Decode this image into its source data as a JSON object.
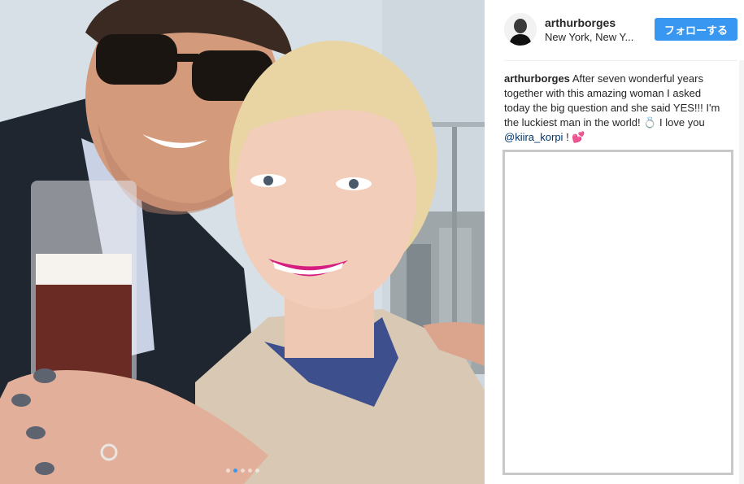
{
  "post": {
    "username": "arthurborges",
    "location": "New York, New Y...",
    "follow_label": "フォローする",
    "caption_user": "arthurborges",
    "caption_text": "After seven wonderful years together with this amazing woman I asked today the big question and she said YES!!! I'm the luckiest man in the world! 💍 I love you ",
    "caption_mention": "@kiira_korpi",
    "caption_end": " ! 💕",
    "carousel_count": 5,
    "carousel_active_index": 1
  },
  "colors": {
    "accent": "#3897f0",
    "mention": "#003569",
    "text": "#262626"
  },
  "icons": [
    "ring-emoji",
    "hearts-emoji"
  ]
}
